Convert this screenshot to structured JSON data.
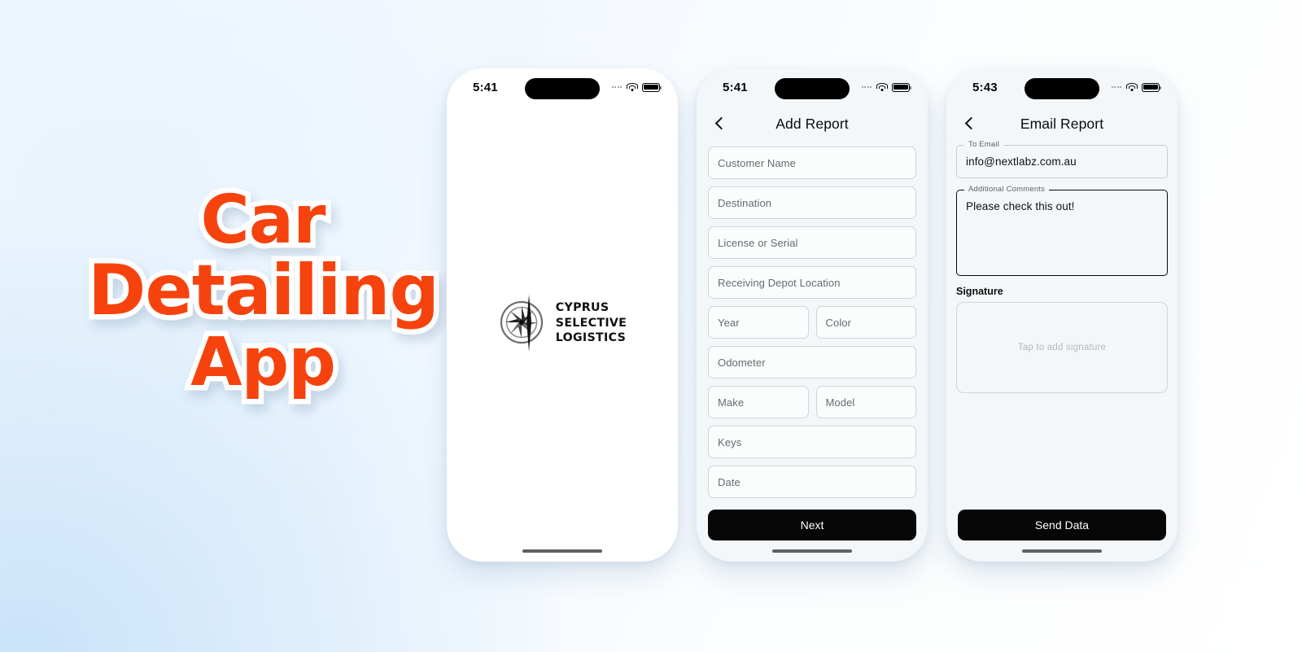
{
  "hero": {
    "line1": "Car",
    "line2": "Detailing",
    "line3": "App",
    "color": "#f6430d",
    "outline_color": "#ffffff"
  },
  "phones": [
    {
      "name": "splash-screen",
      "statusbar": {
        "time": "5:41",
        "wifi_icon": "wifi-icon",
        "battery_icon": "battery-icon",
        "cellular_icon": "cellular-dots-icon"
      },
      "logo": {
        "icon": "compass-rose-icon",
        "line1": "CYPRUS",
        "line2": "SELECTIVE",
        "line3": "LOGISTICS"
      }
    },
    {
      "name": "add-report-screen",
      "statusbar": {
        "time": "5:41",
        "wifi_icon": "wifi-icon",
        "battery_icon": "battery-icon",
        "cellular_icon": "cellular-dots-icon"
      },
      "nav": {
        "back_icon": "back-chevron-icon",
        "title": "Add Report"
      },
      "fields": [
        {
          "placeholder": "Customer Name",
          "value": ""
        },
        {
          "placeholder": "Destination",
          "value": ""
        },
        {
          "placeholder": "License or Serial",
          "value": ""
        },
        {
          "placeholder": "Receiving Depot Location",
          "value": ""
        },
        {
          "placeholder": "Year",
          "value": ""
        },
        {
          "placeholder": "Color",
          "value": ""
        },
        {
          "placeholder": "Odometer",
          "value": ""
        },
        {
          "placeholder": "Make",
          "value": ""
        },
        {
          "placeholder": "Model",
          "value": ""
        },
        {
          "placeholder": "Keys",
          "value": ""
        },
        {
          "placeholder": "Date",
          "value": ""
        }
      ],
      "cta_label": "Next"
    },
    {
      "name": "email-report-screen",
      "statusbar": {
        "time": "5:43",
        "wifi_icon": "wifi-icon",
        "battery_icon": "battery-icon",
        "cellular_icon": "cellular-dots-icon"
      },
      "nav": {
        "back_icon": "back-chevron-icon",
        "title": "Email Report"
      },
      "to_email": {
        "label": "To Email",
        "value": "info@nextlabz.com.au"
      },
      "comments": {
        "label": "Additional Comments",
        "value": "Please check this out!"
      },
      "signature": {
        "label": "Signature",
        "hint": "Tap to add signature"
      },
      "cta_label": "Send Data"
    }
  ]
}
